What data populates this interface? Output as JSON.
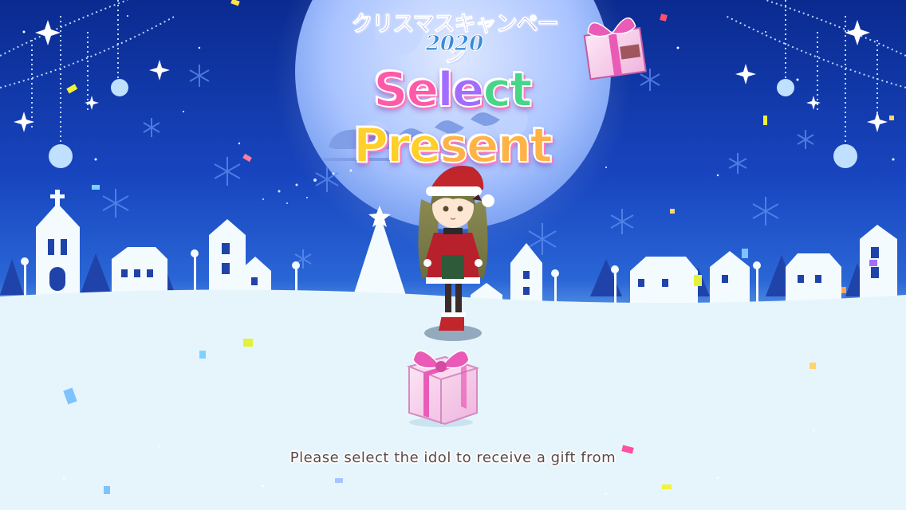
{
  "header": {
    "campaign_title": "クリスマスキャンペーン",
    "campaign_year": "2020",
    "main_title_parts": [
      "Se",
      "le",
      "ct ",
      "Pre",
      "sent"
    ]
  },
  "instruction_text": "Please select the idol to receive a gift from",
  "icons": [
    "moon-icon",
    "sleigh-icon",
    "snowflake-icon",
    "present-icon",
    "idol-avatar"
  ],
  "colors": {
    "sky_top": "#0a2a8f",
    "snow": "#eaf7fd",
    "ribbon": "#e95bb6",
    "box": "#f6cfe9"
  }
}
